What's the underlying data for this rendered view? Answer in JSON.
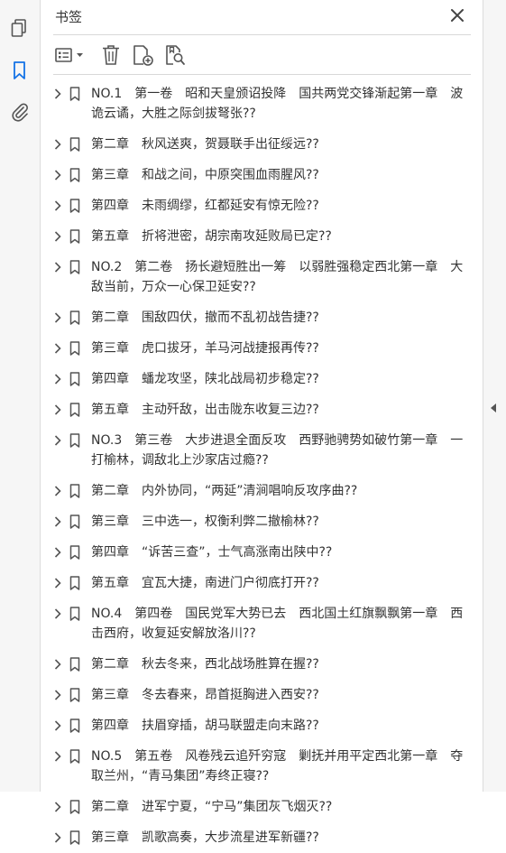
{
  "panel": {
    "title": "书签"
  },
  "icons": {
    "nav_pages": "pages-icon",
    "nav_bookmarks": "bookmark-icon",
    "nav_attachments": "paperclip-icon",
    "close": "close-icon",
    "options": "list-options-icon",
    "delete": "trash-icon",
    "new_bookmark": "new-bookmark-icon",
    "bookmark_from_structure": "bookmark-search-icon"
  },
  "colors": {
    "accent": "#1473e6",
    "icon": "#555555",
    "panel_bg": "#ffffff",
    "bar_bg": "#f6f6f6"
  },
  "bookmarks": [
    {
      "label": "NO.1　第一卷　昭和天皇颁诏投降　国共两党交锋渐起第一章　波诡云谲，大胜之际剑拔弩张??"
    },
    {
      "label": "第二章　秋风送爽，贺聂联手出征绥远??"
    },
    {
      "label": "第三章　和战之间，中原突围血雨腥风??"
    },
    {
      "label": "第四章　未雨绸缪，红都延安有惊无险??"
    },
    {
      "label": "第五章　折将泄密，胡宗南攻延败局已定??"
    },
    {
      "label": "NO.2　第二卷　扬长避短胜出一筹　以弱胜强稳定西北第一章　大敌当前，万众一心保卫延安??"
    },
    {
      "label": "第二章　围敌四伏，撤而不乱初战告捷??"
    },
    {
      "label": "第三章　虎口拔牙，羊马河战捷报再传??"
    },
    {
      "label": "第四章　蟠龙攻坚，陕北战局初步稳定??"
    },
    {
      "label": "第五章　主动歼敌，出击陇东收复三边??"
    },
    {
      "label": "NO.3　第三卷　大步进退全面反攻　西野驰骋势如破竹第一章　一打榆林，调敌北上沙家店过瘾??"
    },
    {
      "label": "第二章　内外协同，“两延”清涧唱响反攻序曲??"
    },
    {
      "label": "第三章　三中选一，权衡利弊二撤榆林??"
    },
    {
      "label": "第四章　“诉苦三查”，士气高涨南出陕中??"
    },
    {
      "label": "第五章　宜瓦大捷，南进门户彻底打开??"
    },
    {
      "label": "NO.4　第四卷　国民党军大势已去　西北国土红旗飘飘第一章　西击西府，收复延安解放洛川??"
    },
    {
      "label": "第二章　秋去冬来，西北战场胜算在握??"
    },
    {
      "label": "第三章　冬去春来，昂首挺胸进入西安??"
    },
    {
      "label": "第四章　扶眉穿插，胡马联盟走向末路??"
    },
    {
      "label": "NO.5　第五卷　风卷残云追歼穷寇　剿抚并用平定西北第一章　夺取兰州，“青马集团”寿终正寝??"
    },
    {
      "label": "第二章　进军宁夏，“宁马”集团灰飞烟灭??"
    },
    {
      "label": "第三章　凯歌高奏，大步流星进军新疆??"
    }
  ]
}
